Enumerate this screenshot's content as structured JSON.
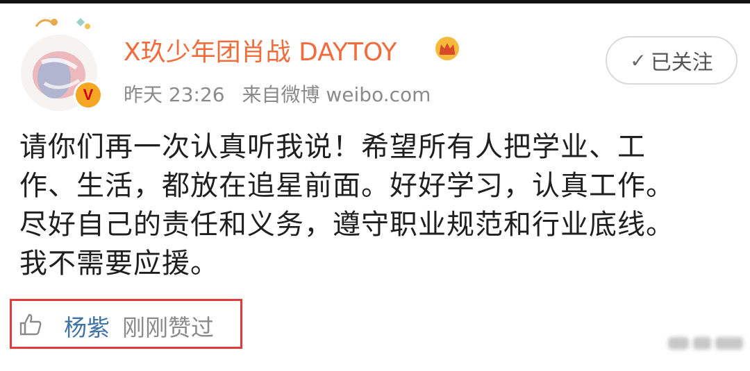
{
  "post": {
    "username": "X玖少年团肖战 DAYTOY",
    "time": "昨天 23:26",
    "source": "来自微博 weibo.com",
    "follow_label": "已关注",
    "follow_icon": "✓",
    "verified_mark": "V",
    "content_lines": [
      "请你们再一次认真听我说！希望所有人把学业、工",
      "作、生活，都放在追星前面。好好学习，认真工作。",
      "尽好自己的责任和义务，遵守职业规范和行业底线。",
      "我不需要应援。"
    ]
  },
  "like": {
    "user": "杨紫",
    "action": "刚刚赞过"
  },
  "colors": {
    "username": "#f26b3a",
    "like_user": "#3f74a8",
    "highlight_box": "#e23a3a",
    "meta": "#8a8a8a"
  }
}
